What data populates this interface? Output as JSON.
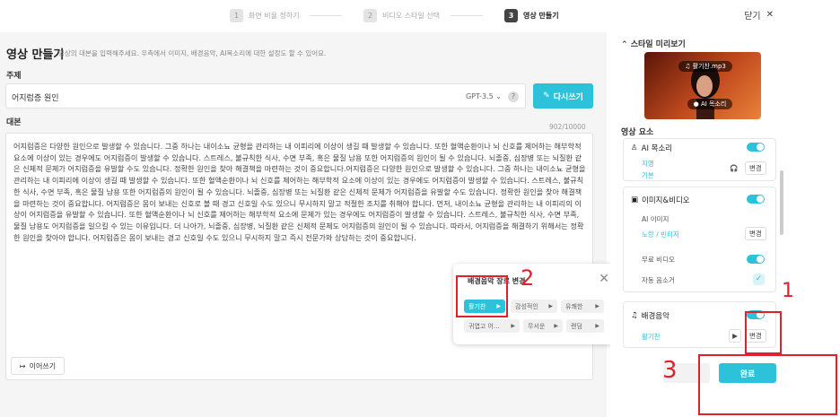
{
  "stepper": [
    {
      "num": "1",
      "label": "화면 비율 정하기"
    },
    {
      "num": "2",
      "label": "비디오 스타일 선택"
    },
    {
      "num": "3",
      "label": "영상 만들기"
    }
  ],
  "close_label": "닫기",
  "page": {
    "title": "영상 만들기",
    "subtitle": "영상의 대본을 입력해주세요. 우측에서 이미지, 배경음악, AI목소리에 대한 설정도 할 수 있어요.",
    "topic_label": "주제",
    "topic_value": "어지럼증 원인",
    "model": "GPT-3.5",
    "help": "?",
    "rewrite": "다시쓰기",
    "script_label": "대본",
    "counter": "902/10000",
    "script": "어지럼증은 다양한 원인으로 발생할 수 있습니다. 그중 하나는 내이소뇨 균형을 관리하는 내 이피리에 이상이 생길 때 발생할 수 있습니다. 또한 혈액순환이나 뇌 신호를 제어하는 해부학적 요소에 이상이 있는 경우에도 어지럼증이 발생할 수 있습니다. 스트레스, 불규칙한 식사, 수면 부족, 혹은 물질 남용 또한 어지럼증의 원인이 될 수 있습니다. 뇌졸중, 심장병 또는 뇌질환 같은 신체적 문제가 어지럼증을 유발할 수도 있습니다. 정확한 원인을 찾아 해결책을 마련하는 것이 중요합니다.어지럼증은 다양한 원인으로 발생할 수 있습니다. 그중 하나는 내이소뇨 균형을 관리하는 내 이피리에 이상이 생길 때 발생할 수 있습니다. 또한 혈액순환이나 뇌 신호를 제어하는 해부학적 요소에 이상이 있는 경우에도 어지럼증이 발생할 수 있습니다. 스트레스, 불규칙한 식사, 수면 부족, 혹은 물질 남용 또한 어지럼증의 원인이 될 수 있습니다. 뇌졸중, 심장병 또는 뇌질환 같은 신체적 문제가 어지럼증을 유발할 수도 있습니다. 정확한 원인을 찾아 해결책을 마련하는 것이 중요합니다. 어지럼증은 몸이 보내는 신호로 볼 때 경고 신호일 수도 있으니 무시하지 말고 적절한 조치를 취해야 합니다. 먼저, 내이소뇨 균형을 관리하는 내 이피리의 이상이 어지럼증을 유발할 수 있습니다. 또한 혈액순환이나 뇌 신호를 제어하는 해부학적 요소에 문제가 있는 경우에도 어지럼증이 발생할 수 있습니다. 스트레스, 불규칙한 식사, 수면 부족, 물질 남용도 어지럼증을 일으킬 수 있는 이유입니다. 더 나아가, 뇌졸중, 심장병, 뇌질환 같은 신체적 문제도 어지럼증의 원인이 될 수 있습니다. 따라서, 어지럼증을 해결하기 위해서는 정확한 원인을 찾아야 합니다. 어지럼증은 몸이 보내는 경고 신호일 수도 있으니 무시하지 말고 즉시 전문가와 상담하는 것이 중요합니다.",
    "continue": "이어쓰기"
  },
  "popup": {
    "title": "배경음악 장르 변경",
    "chips": [
      {
        "label": "활기찬",
        "selected": true
      },
      {
        "label": "감성적인",
        "selected": false
      },
      {
        "label": "유쾌한",
        "selected": false
      },
      {
        "label": "귀엽고 어...",
        "selected": false
      },
      {
        "label": "무서운",
        "selected": false
      },
      {
        "label": "랜덤",
        "selected": false
      }
    ]
  },
  "style_preview": {
    "header": "스타일 미리보기",
    "music_tag": "활기찬.mp3",
    "voice_tag": "AI 목소리"
  },
  "elements": {
    "header": "영상 요소",
    "voice": {
      "title": "AI 목소리",
      "name": "지영",
      "type": "기본",
      "change": "변경"
    },
    "image_video": {
      "title": "이미지&비디오",
      "ai_image": "AI 이미지",
      "style": "노랑 / 빈티지",
      "change": "변경",
      "free_video": "무료 비디오",
      "auto_sound": "자동 음소거"
    },
    "music": {
      "title": "배경음악",
      "value": "활기찬",
      "change": "변경"
    }
  },
  "actions": {
    "done": "완료"
  },
  "annotations": [
    "1",
    "2",
    "3"
  ],
  "colors": {
    "accent": "#2cc3da",
    "annotation": "#e0202a"
  }
}
